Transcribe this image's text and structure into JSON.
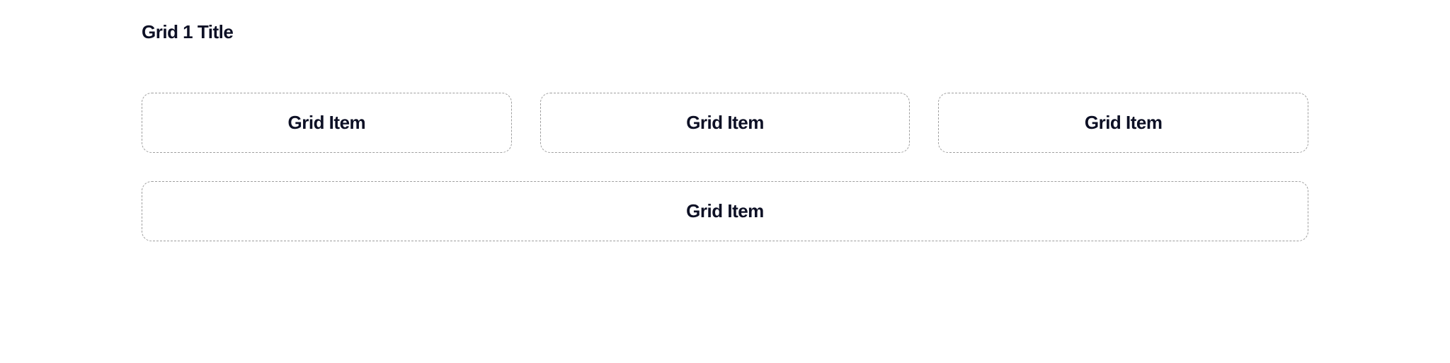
{
  "grid": {
    "title": "Grid 1 Title",
    "rows": [
      {
        "items": [
          {
            "label": "Grid Item"
          },
          {
            "label": "Grid Item"
          },
          {
            "label": "Grid Item"
          }
        ]
      },
      {
        "items": [
          {
            "label": "Grid Item"
          }
        ]
      }
    ]
  }
}
